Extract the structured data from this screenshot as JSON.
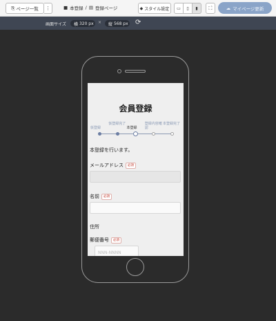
{
  "toolbar": {
    "pages_label": "ページ一覧",
    "more_label": "⋮",
    "breadcrumb": {
      "section": "本登録",
      "separator": "/",
      "page": "登録ページ"
    },
    "style_label": "スタイル設定",
    "publish_label": "マイページ更新",
    "colors": {
      "publish": "#8aa4c8"
    }
  },
  "sizebar": {
    "label": "画面サイズ",
    "width_prefix": "横",
    "width_value": "320 px",
    "times": "×",
    "height_prefix": "縦",
    "height_value": "568 px"
  },
  "form": {
    "title": "会員登録",
    "steps": [
      {
        "label": "仮登録",
        "state": "done"
      },
      {
        "label": "仮登録完了",
        "state": "done"
      },
      {
        "label": "本登録",
        "state": "current"
      },
      {
        "label": "登録内容確認",
        "state": "todo"
      },
      {
        "label": "本登録完了",
        "state": "todo"
      }
    ],
    "intro": "本登録を行います。",
    "email_label": "メールアドレス",
    "name_label": "名前",
    "address_label": "住所",
    "postal_label": "郵便番号",
    "required_badge": "必須",
    "postal_placeholder": "NNN-NNNN"
  }
}
